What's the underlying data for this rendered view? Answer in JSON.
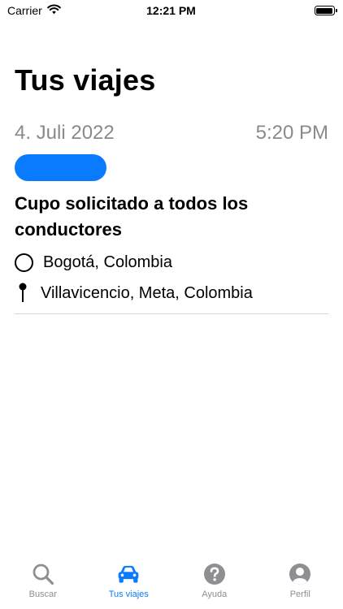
{
  "status_bar": {
    "carrier": "Carrier",
    "time": "12:21 PM"
  },
  "page": {
    "title": "Tus viajes"
  },
  "trip": {
    "date": "4. Juli 2022",
    "time": "5:20 PM",
    "status_text": "Cupo solicitado a todos los conductores",
    "status_pill_color": "#0a7bff",
    "origin": "Bogotá, Colombia",
    "destination": "Villavicencio, Meta, Colombia"
  },
  "tab_bar": {
    "active_color": "#0a7bff",
    "inactive_color": "#8e8e93",
    "tabs": [
      {
        "label": "Buscar",
        "icon": "search-icon",
        "active": false
      },
      {
        "label": "Tus viajes",
        "icon": "car-icon",
        "active": true
      },
      {
        "label": "Ayuda",
        "icon": "help-icon",
        "active": false
      },
      {
        "label": "Perfil",
        "icon": "profile-icon",
        "active": false
      }
    ]
  }
}
